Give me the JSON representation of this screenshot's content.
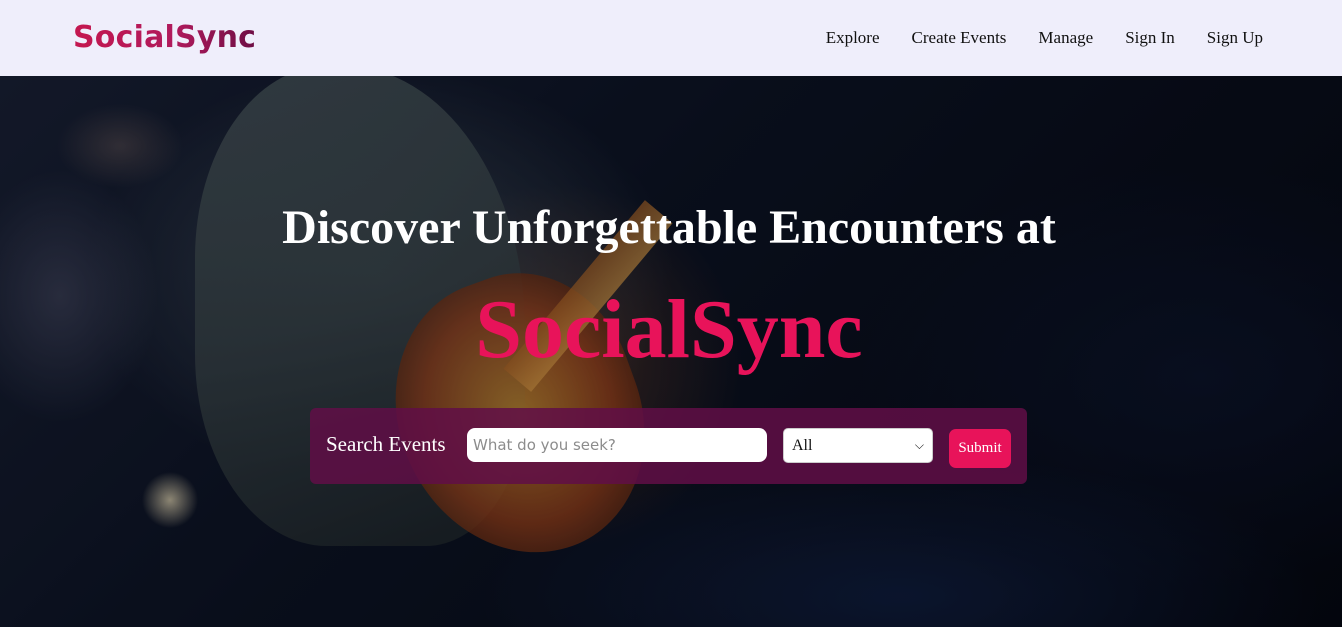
{
  "header": {
    "logo": "SocialSync",
    "nav": [
      {
        "label": "Explore"
      },
      {
        "label": "Create Events"
      },
      {
        "label": "Manage"
      },
      {
        "label": "Sign In"
      },
      {
        "label": "Sign Up"
      }
    ]
  },
  "hero": {
    "title": "Discover Unforgettable Encounters at",
    "brand": "SocialSync",
    "search": {
      "label": "Search Events",
      "placeholder": "What do you seek?",
      "value": "",
      "category_selected": "All",
      "submit_label": "Submit"
    }
  },
  "colors": {
    "accent": "#e8135a",
    "header_bg": "#efeefb",
    "search_bar_bg": "#600e46"
  },
  "icons": {
    "select_arrow": "chevron-down-icon"
  }
}
